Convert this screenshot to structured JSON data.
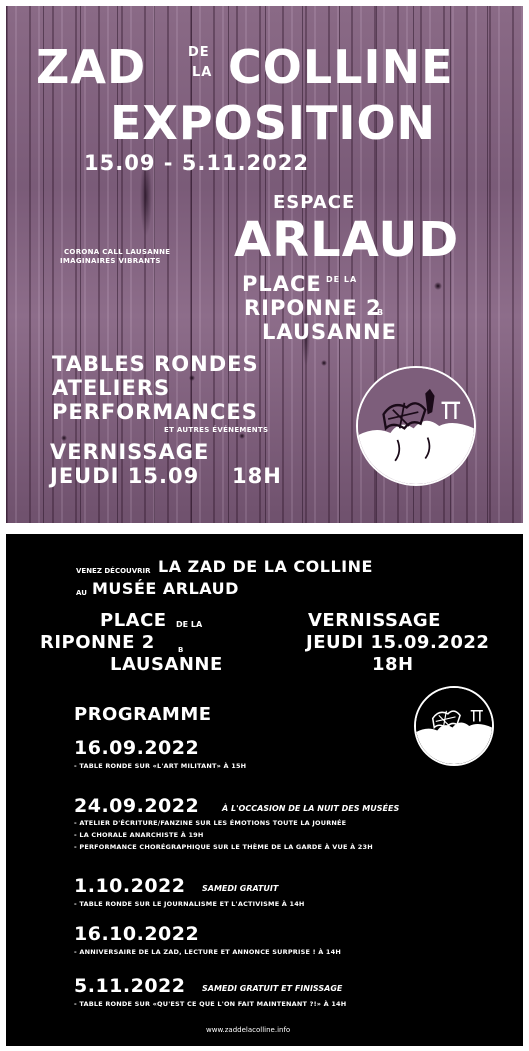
{
  "poster_top": {
    "zad": "ZAD",
    "de": "DE",
    "la": "LA",
    "colline": "COLLINE",
    "exposition": "EXPOSITION",
    "dates": "15.09 - 5.11.2022",
    "espace": "ESPACE",
    "arlaud": "ARLAUD",
    "credit_1": "CORONA CALL LAUSANNE",
    "credit_2": "IMAGINAIRES VIBRANTS",
    "place": "PLACE",
    "de_la_small": "DE LA",
    "riponne": "RIPONNE 2",
    "riponne_b": "B",
    "lausanne": "LAUSANNE",
    "tables": "TABLES RONDES",
    "ateliers": "ATELIERS",
    "performances": "PERFORMANCES",
    "autres": "ET AUTRES ÉVÉNEMENTS",
    "vernissage": "VERNISSAGE",
    "jeudi": "JEUDI 15.09",
    "heure": "18H",
    "logo_icon": "zad-logo-icon",
    "bg_color": "#7d5e7b"
  },
  "poster_bottom": {
    "venez": "VENEZ DÉCOUVRIR",
    "title": "LA ZAD DE LA COLLINE",
    "au": "AU",
    "musee": "MUSÉE ARLAUD",
    "place": "PLACE",
    "de_la": "DE LA",
    "riponne": "RIPONNE 2",
    "riponne_b": "B",
    "lausanne": "LAUSANNE",
    "vernissage": "VERNISSAGE",
    "jeudi": "JEUDI 15.09.2022",
    "heure": "18H",
    "programme": "PROGRAMME",
    "events": [
      {
        "date": "16.09.2022",
        "note": "",
        "items": [
          "- TABLE RONDE SUR «L'ART MILITANT» À 15H"
        ]
      },
      {
        "date": "24.09.2022",
        "note": "À L'OCCASION DE LA NUIT DES MUSÉES",
        "items": [
          "- ATELIER D'ÉCRITURE/FANZINE SUR LES ÉMOTIONS TOUTE LA JOURNÉE",
          "- LA CHORALE ANARCHISTE À 19H",
          "- PERFORMANCE CHORÉGRAPHIQUE SUR LE THÈME DE LA GARDE À VUE À 23H"
        ]
      },
      {
        "date": "1.10.2022",
        "note": "SAMEDI GRATUIT",
        "items": [
          "- TABLE RONDE SUR LE JOURNALISME ET L'ACTIVISME À 14H"
        ]
      },
      {
        "date": "16.10.2022",
        "note": "",
        "items": [
          "- ANNIVERSAIRE DE LA ZAD, LECTURE ET ANNONCE SURPRISE ! À 14H"
        ]
      },
      {
        "date": "5.11.2022",
        "note": "SAMEDI GRATUIT ET FINISSAGE",
        "items": [
          "- TABLE RONDE SUR «QU'EST CE QUE L'ON FAIT MAINTENANT ?!» À 14H"
        ]
      }
    ],
    "website": "www.zaddelacolline.info",
    "logo_icon": "zad-logo-icon"
  }
}
